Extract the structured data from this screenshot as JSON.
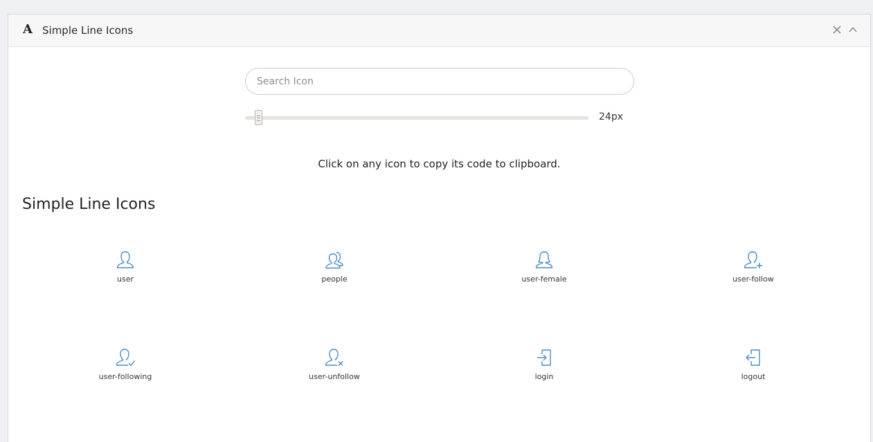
{
  "window": {
    "logo_glyph": "A",
    "title": "Simple Line Icons",
    "close_glyph": "✕",
    "collapse_glyph": "^"
  },
  "search": {
    "placeholder": "Search Icon",
    "value": ""
  },
  "size_slider": {
    "value_label": "24px",
    "value": 24
  },
  "hint_text": "Click on any icon to copy its code to clipboard.",
  "section": {
    "title": "Simple Line Icons"
  },
  "icons": [
    {
      "label": "user",
      "icon": "user-icon"
    },
    {
      "label": "people",
      "icon": "people-icon"
    },
    {
      "label": "user-female",
      "icon": "user-female-icon"
    },
    {
      "label": "user-follow",
      "icon": "user-follow-icon"
    },
    {
      "label": "user-following",
      "icon": "user-following-icon"
    },
    {
      "label": "user-unfollow",
      "icon": "user-unfollow-icon"
    },
    {
      "label": "login",
      "icon": "login-icon"
    },
    {
      "label": "logout",
      "icon": "logout-icon"
    }
  ],
  "colors": {
    "icon": "#4a8cc0",
    "text": "#222222",
    "titlebar_bg": "#f7f7f7"
  }
}
